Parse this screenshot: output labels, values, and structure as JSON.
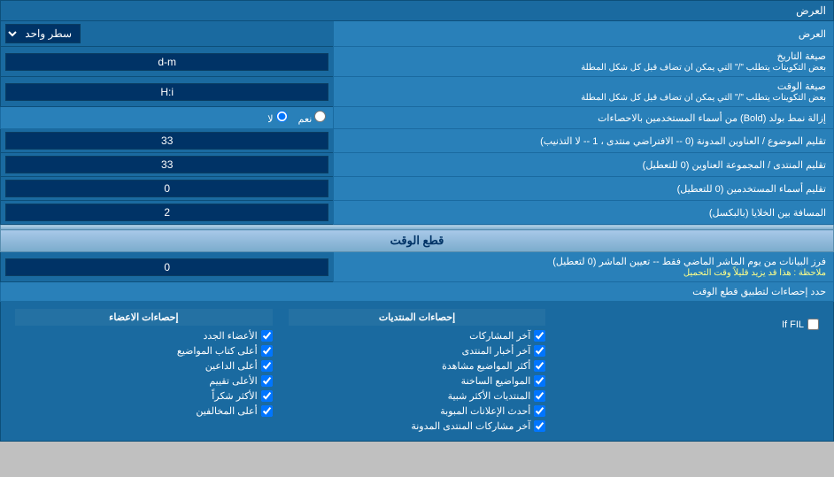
{
  "page": {
    "title": "العرض",
    "display_mode_label": "العرض",
    "display_mode_value": "سطر واحد",
    "date_format_label": "صيغة التاريخ",
    "date_format_note": "بعض التكوينات يتطلب \"/\" التي يمكن ان تضاف قبل كل شكل المطلة",
    "date_format_value": "d-m",
    "time_format_label": "صيغة الوقت",
    "time_format_note": "بعض التكوينات يتطلب \"/\" التي يمكن ان تضاف قبل كل شكل المطلة",
    "time_format_value": "H:i",
    "bold_label": "إزالة نمط بولد (Bold) من أسماء المستخدمين بالاحصاءات",
    "bold_yes": "نعم",
    "bold_no": "لا",
    "bold_selected": "no",
    "topics_order_label": "تقليم الموضوع / العناوين المدونة (0 -- الافتراضي منتدى ، 1 -- لا التذنيب)",
    "topics_order_value": "33",
    "forum_group_label": "تقليم المنتدى / المجموعة العناوين (0 للتعطيل)",
    "forum_group_value": "33",
    "users_trim_label": "تقليم أسماء المستخدمين (0 للتعطيل)",
    "users_trim_value": "0",
    "spacing_label": "المسافة بين الخلايا (بالبكسل)",
    "spacing_value": "2",
    "cutoff_section": "قطع الوقت",
    "cutoff_label": "فرز البيانات من يوم الماشر الماضي فقط -- تعيين الماشر (0 لتعطيل)",
    "cutoff_note": "ملاحظة : هذا قد يزيد قليلاً وقت التحميل",
    "cutoff_value": "0",
    "limit_label": "حدد إحصاءات لتطبيق قطع الوقت",
    "col1_header": "إحصاءات الاعضاء",
    "col2_header": "إحصاءات المنتديات",
    "col3_header": "",
    "col1_items": [
      "الأعضاء الجدد",
      "أعلى كتاب المواضيع",
      "أعلى الداعين",
      "الأعلى تقييم",
      "الأكثر شكراً",
      "أعلى المخالفين"
    ],
    "col2_items": [
      "آخر المشاركات",
      "آخر أخبار المنتدى",
      "أكثر المواضيع مشاهدة",
      "المواضيع الساخنة",
      "المنتديات الأكثر شبية",
      "أحدث الإعلانات المبوبة",
      "آخر مشاركات المنتدى المدونة"
    ],
    "col3_label": "If FIL"
  }
}
